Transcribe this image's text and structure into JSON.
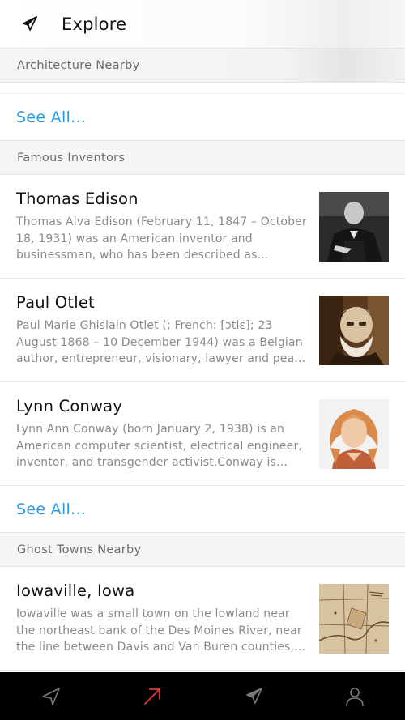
{
  "header": {
    "title": "Explore",
    "icon": "compass-icon"
  },
  "sections": {
    "architecture": {
      "title": "Architecture Nearby"
    },
    "architecture_see_all": "See All...",
    "inventors": {
      "title": "Famous Inventors",
      "items": [
        {
          "title": "Thomas Edison",
          "description": "Thomas Alva Edison (February 11, 1847 – October 18, 1931) was an American inventor and businessman, who has been described as America's greatest inventor."
        },
        {
          "title": "Paul Otlet",
          "description": "Paul Marie Ghislain Otlet (; French: [ɔtlɛ]; 23 August 1868 – 10 December 1944) was a Belgian author, entrepreneur, visionary, lawyer and peace activist."
        },
        {
          "title": "Lynn Conway",
          "description": "Lynn Ann Conway (born January 2, 1938) is an American computer scientist, electrical engineer, inventor, and transgender activist.Conway is notable for a number of pioneering achievements."
        }
      ],
      "see_all": "See All..."
    },
    "ghost_towns": {
      "title": "Ghost Towns Nearby",
      "items": [
        {
          "title": "Iowaville, Iowa",
          "description": "Iowaville was a small town on the lowland near the northeast bank of the Des Moines River, near the line between Davis and Van Buren counties, and became a trading post."
        }
      ]
    }
  },
  "bottom_nav": {
    "items": [
      "navigate-icon",
      "trending-arrow-icon",
      "compass-icon",
      "profile-icon"
    ],
    "active_color": "#e03a3a",
    "inactive_color": "#7a7a7a"
  },
  "colors": {
    "link": "#2a9be6",
    "section_bg": "#f5f5f5"
  }
}
